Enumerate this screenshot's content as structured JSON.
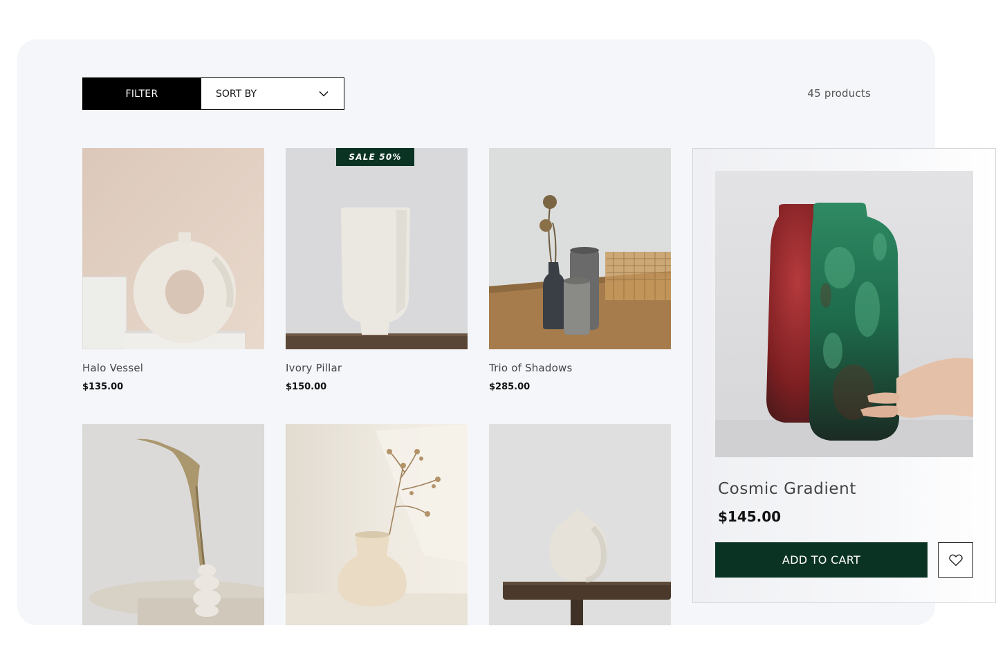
{
  "toolbar": {
    "filter_label": "FILTER",
    "sort_label": "SORT BY",
    "sort_icon": "chevron-down-icon",
    "product_count": "45 products"
  },
  "products": [
    {
      "name": "Halo Vessel",
      "price": "$135.00"
    },
    {
      "name": "Ivory Pillar",
      "price": "$150.00",
      "badge": "SALE 50%"
    },
    {
      "name": "Trio of Shadows",
      "price": "$285.00"
    },
    {
      "name": "",
      "price": ""
    },
    {
      "name": "",
      "price": ""
    },
    {
      "name": "",
      "price": ""
    }
  ],
  "featured": {
    "name": "Cosmic Gradient",
    "price": "$145.00",
    "add_to_cart_label": "ADD TO CART",
    "wishlist_icon": "heart-icon"
  },
  "colors": {
    "primary_dark_green": "#0b3324",
    "filter_black": "#000000",
    "panel_background": "#f4f6fa"
  }
}
